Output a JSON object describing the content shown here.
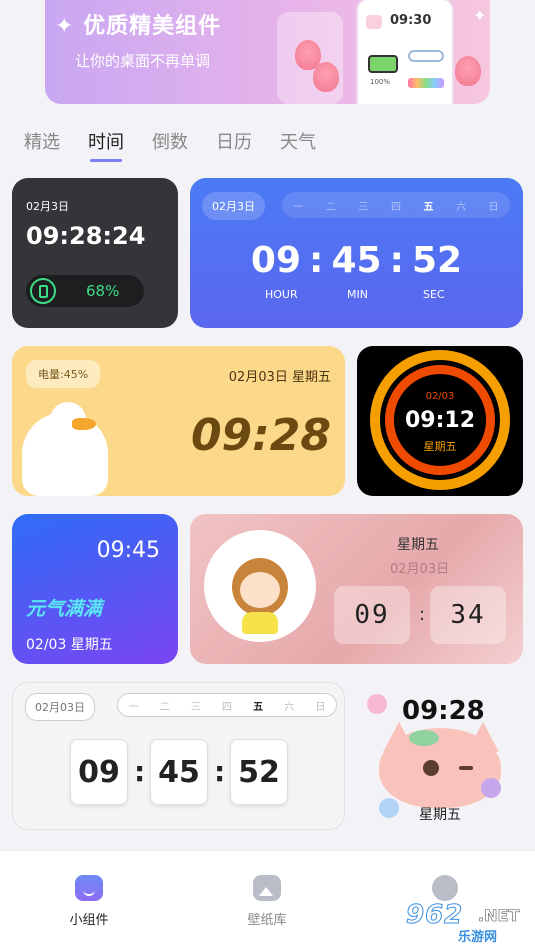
{
  "banner": {
    "title": "优质精美组件",
    "subtitle": "让你的桌面不再单调",
    "preview_time": "09:30",
    "preview_battery": "100%"
  },
  "tabs": [
    {
      "label": "精选",
      "active": false
    },
    {
      "label": "时间",
      "active": true
    },
    {
      "label": "倒数",
      "active": false
    },
    {
      "label": "日历",
      "active": false
    },
    {
      "label": "天气",
      "active": false
    }
  ],
  "widgets": {
    "dark_clock": {
      "date": "02月3日",
      "time": "09:28:24",
      "battery": "68%"
    },
    "blue_clock": {
      "date": "02月3日",
      "weekdays": [
        "一",
        "二",
        "三",
        "四",
        "五",
        "六",
        "日"
      ],
      "hour": "09",
      "minute": "45",
      "second": "52",
      "sep": ":",
      "hour_label": "HOUR",
      "min_label": "MIN",
      "sec_label": "SEC"
    },
    "duck_clock": {
      "battery": "电量:45%",
      "date": "02月03日 星期五",
      "time": "09:28"
    },
    "ring_clock": {
      "date": "02/03",
      "time": "09:12",
      "weekday": "星期五"
    },
    "gradient_clock": {
      "time": "09:45",
      "slogan": "元气满满",
      "date": "02/03 星期五"
    },
    "pink_clock": {
      "weekday": "星期五",
      "date": "02月03日",
      "hour": "09",
      "minute": "34",
      "sep": ":"
    },
    "flip_clock": {
      "date": "02月03日",
      "weekdays": [
        "一",
        "二",
        "三",
        "四",
        "五",
        "六",
        "日"
      ],
      "hour": "09",
      "minute": "45",
      "second": "52",
      "sep": ":"
    },
    "cat_clock": {
      "time": "09:28",
      "weekday": "星期五"
    }
  },
  "nav": {
    "items": [
      {
        "label": "小组件",
        "icon": "widget-icon",
        "active": true
      },
      {
        "label": "壁纸库",
        "icon": "wallpaper-icon",
        "active": false
      },
      {
        "label": "",
        "icon": "profile-icon",
        "active": false
      }
    ]
  },
  "watermark": {
    "number": "962",
    "domain": ".NET",
    "text": "乐游网"
  },
  "colors": {
    "accent": "#7a80f0",
    "blue_card": "#4b7bf5",
    "yellow_card": "#fcd98a",
    "ring_orange": "#f5a000",
    "ring_red": "#f04a00",
    "slogan": "#5ce6f5"
  }
}
